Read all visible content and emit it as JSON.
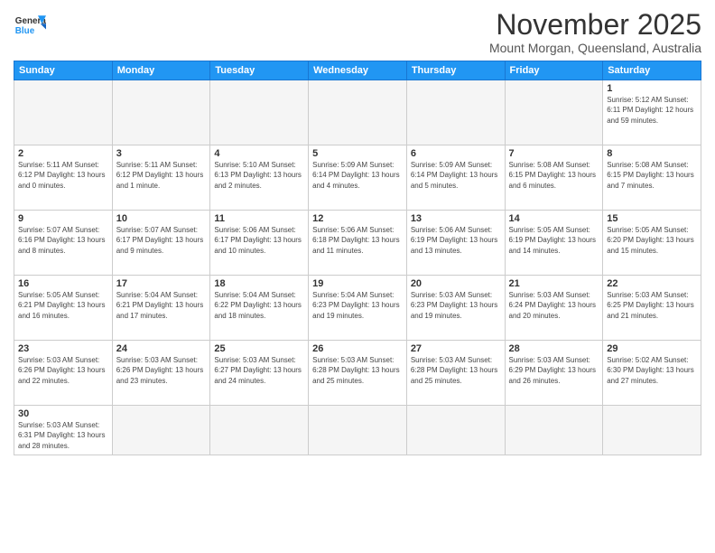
{
  "logo": {
    "line1": "General",
    "line2": "Blue"
  },
  "title": "November 2025",
  "subtitle": "Mount Morgan, Queensland, Australia",
  "days_header": [
    "Sunday",
    "Monday",
    "Tuesday",
    "Wednesday",
    "Thursday",
    "Friday",
    "Saturday"
  ],
  "weeks": [
    [
      {
        "day": "",
        "info": ""
      },
      {
        "day": "",
        "info": ""
      },
      {
        "day": "",
        "info": ""
      },
      {
        "day": "",
        "info": ""
      },
      {
        "day": "",
        "info": ""
      },
      {
        "day": "",
        "info": ""
      },
      {
        "day": "1",
        "info": "Sunrise: 5:12 AM\nSunset: 6:11 PM\nDaylight: 12 hours and 59 minutes."
      }
    ],
    [
      {
        "day": "2",
        "info": "Sunrise: 5:11 AM\nSunset: 6:12 PM\nDaylight: 13 hours and 0 minutes."
      },
      {
        "day": "3",
        "info": "Sunrise: 5:11 AM\nSunset: 6:12 PM\nDaylight: 13 hours and 1 minute."
      },
      {
        "day": "4",
        "info": "Sunrise: 5:10 AM\nSunset: 6:13 PM\nDaylight: 13 hours and 2 minutes."
      },
      {
        "day": "5",
        "info": "Sunrise: 5:09 AM\nSunset: 6:14 PM\nDaylight: 13 hours and 4 minutes."
      },
      {
        "day": "6",
        "info": "Sunrise: 5:09 AM\nSunset: 6:14 PM\nDaylight: 13 hours and 5 minutes."
      },
      {
        "day": "7",
        "info": "Sunrise: 5:08 AM\nSunset: 6:15 PM\nDaylight: 13 hours and 6 minutes."
      },
      {
        "day": "8",
        "info": "Sunrise: 5:08 AM\nSunset: 6:15 PM\nDaylight: 13 hours and 7 minutes."
      }
    ],
    [
      {
        "day": "9",
        "info": "Sunrise: 5:07 AM\nSunset: 6:16 PM\nDaylight: 13 hours and 8 minutes."
      },
      {
        "day": "10",
        "info": "Sunrise: 5:07 AM\nSunset: 6:17 PM\nDaylight: 13 hours and 9 minutes."
      },
      {
        "day": "11",
        "info": "Sunrise: 5:06 AM\nSunset: 6:17 PM\nDaylight: 13 hours and 10 minutes."
      },
      {
        "day": "12",
        "info": "Sunrise: 5:06 AM\nSunset: 6:18 PM\nDaylight: 13 hours and 11 minutes."
      },
      {
        "day": "13",
        "info": "Sunrise: 5:06 AM\nSunset: 6:19 PM\nDaylight: 13 hours and 13 minutes."
      },
      {
        "day": "14",
        "info": "Sunrise: 5:05 AM\nSunset: 6:19 PM\nDaylight: 13 hours and 14 minutes."
      },
      {
        "day": "15",
        "info": "Sunrise: 5:05 AM\nSunset: 6:20 PM\nDaylight: 13 hours and 15 minutes."
      }
    ],
    [
      {
        "day": "16",
        "info": "Sunrise: 5:05 AM\nSunset: 6:21 PM\nDaylight: 13 hours and 16 minutes."
      },
      {
        "day": "17",
        "info": "Sunrise: 5:04 AM\nSunset: 6:21 PM\nDaylight: 13 hours and 17 minutes."
      },
      {
        "day": "18",
        "info": "Sunrise: 5:04 AM\nSunset: 6:22 PM\nDaylight: 13 hours and 18 minutes."
      },
      {
        "day": "19",
        "info": "Sunrise: 5:04 AM\nSunset: 6:23 PM\nDaylight: 13 hours and 19 minutes."
      },
      {
        "day": "20",
        "info": "Sunrise: 5:03 AM\nSunset: 6:23 PM\nDaylight: 13 hours and 19 minutes."
      },
      {
        "day": "21",
        "info": "Sunrise: 5:03 AM\nSunset: 6:24 PM\nDaylight: 13 hours and 20 minutes."
      },
      {
        "day": "22",
        "info": "Sunrise: 5:03 AM\nSunset: 6:25 PM\nDaylight: 13 hours and 21 minutes."
      }
    ],
    [
      {
        "day": "23",
        "info": "Sunrise: 5:03 AM\nSunset: 6:26 PM\nDaylight: 13 hours and 22 minutes."
      },
      {
        "day": "24",
        "info": "Sunrise: 5:03 AM\nSunset: 6:26 PM\nDaylight: 13 hours and 23 minutes."
      },
      {
        "day": "25",
        "info": "Sunrise: 5:03 AM\nSunset: 6:27 PM\nDaylight: 13 hours and 24 minutes."
      },
      {
        "day": "26",
        "info": "Sunrise: 5:03 AM\nSunset: 6:28 PM\nDaylight: 13 hours and 25 minutes."
      },
      {
        "day": "27",
        "info": "Sunrise: 5:03 AM\nSunset: 6:28 PM\nDaylight: 13 hours and 25 minutes."
      },
      {
        "day": "28",
        "info": "Sunrise: 5:03 AM\nSunset: 6:29 PM\nDaylight: 13 hours and 26 minutes."
      },
      {
        "day": "29",
        "info": "Sunrise: 5:02 AM\nSunset: 6:30 PM\nDaylight: 13 hours and 27 minutes."
      }
    ],
    [
      {
        "day": "30",
        "info": "Sunrise: 5:03 AM\nSunset: 6:31 PM\nDaylight: 13 hours and 28 minutes."
      },
      {
        "day": "",
        "info": ""
      },
      {
        "day": "",
        "info": ""
      },
      {
        "day": "",
        "info": ""
      },
      {
        "day": "",
        "info": ""
      },
      {
        "day": "",
        "info": ""
      },
      {
        "day": "",
        "info": ""
      }
    ]
  ]
}
